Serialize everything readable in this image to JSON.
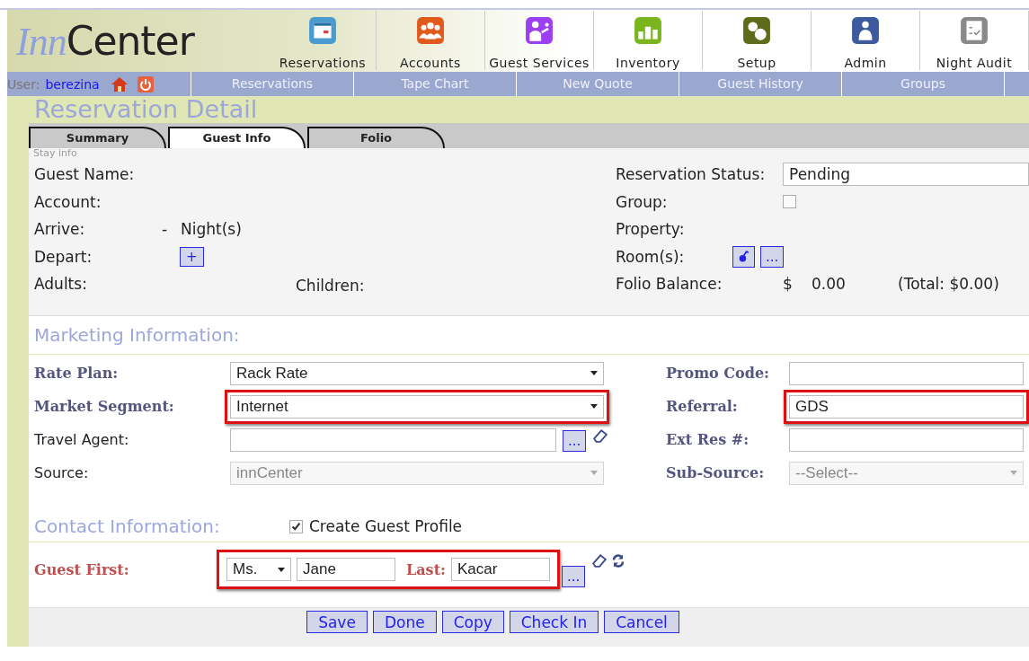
{
  "header": {
    "logo": {
      "prefix": "Inn",
      "suffix": "Center"
    },
    "modules": [
      {
        "label": "Reservations",
        "kind": "calendar"
      },
      {
        "label": "Accounts",
        "kind": "people"
      },
      {
        "label": "Guest Services",
        "kind": "service"
      },
      {
        "label": "Inventory",
        "kind": "chart"
      },
      {
        "label": "Setup",
        "kind": "gears"
      },
      {
        "label": "Admin",
        "kind": "person"
      },
      {
        "label": "Night Audit",
        "kind": "checklist"
      }
    ]
  },
  "user_bar": {
    "label": "User:",
    "name": "berezina"
  },
  "nav": [
    "Reservations",
    "Tape Chart",
    "New Quote",
    "Guest History",
    "Groups"
  ],
  "page_title": "Reservation Detail",
  "tabs": [
    {
      "label": "Summary",
      "selected": false
    },
    {
      "label": "Guest Info",
      "selected": true
    },
    {
      "label": "Folio",
      "selected": false
    }
  ],
  "stay_info": {
    "caption": "Stay info",
    "guest_name_label": "Guest Name:",
    "account_label": "Account:",
    "arrive_label": "Arrive:",
    "arrive_dash": "-",
    "nights_label": "Night(s)",
    "depart_label": "Depart:",
    "add_button": "+",
    "adults_label": "Adults:",
    "children_label": "Children:",
    "status_label": "Reservation Status:",
    "status_value": "Pending",
    "group_label": "Group:",
    "group_checked": false,
    "property_label": "Property:",
    "rooms_label": "Room(s):",
    "rooms_more_button": "...",
    "folio_label": "Folio Balance:",
    "folio_currency": "$",
    "folio_amount": "0.00",
    "folio_total": "(Total: $0.00)"
  },
  "marketing": {
    "heading": "Marketing Information:",
    "rows": [
      {
        "left": {
          "label": "Rate Plan:",
          "required": true,
          "kind": "select",
          "value": "Rack Rate",
          "highlighted": false,
          "disabled": false
        },
        "right": {
          "label": "Promo Code:",
          "required": true,
          "kind": "input",
          "highlighted": false,
          "disabled": false
        }
      },
      {
        "left": {
          "label": "Market Segment:",
          "required": true,
          "kind": "select",
          "value": "Internet",
          "highlighted": true,
          "disabled": false
        },
        "right": {
          "label": "Referral:",
          "required": true,
          "kind": "input",
          "value": "GDS",
          "highlighted": true,
          "disabled": false
        }
      },
      {
        "left": {
          "label": "Travel Agent:",
          "required": false,
          "kind": "lookup",
          "lookup_button": "...",
          "highlighted": false,
          "disabled": false
        },
        "right": {
          "label": "Ext Res #:",
          "required": true,
          "kind": "input",
          "highlighted": false,
          "disabled": false
        }
      },
      {
        "left": {
          "label": "Source:",
          "required": false,
          "kind": "select",
          "value": "innCenter",
          "highlighted": false,
          "disabled": true
        },
        "right": {
          "label": "Sub-Source:",
          "required": true,
          "kind": "select",
          "value": "--Select--",
          "highlighted": false,
          "disabled": true
        }
      }
    ]
  },
  "contact": {
    "heading": "Contact Information:",
    "create_profile": {
      "label": "Create Guest Profile",
      "checked": true
    },
    "first_label": "Guest First:",
    "title_value": "Ms.",
    "first_value": "Jane",
    "last_label": "Last:",
    "last_value": "Kacar",
    "lookup_button": "...",
    "highlighted": true
  },
  "buttons": [
    "Save",
    "Done",
    "Copy",
    "Check In",
    "Cancel"
  ]
}
